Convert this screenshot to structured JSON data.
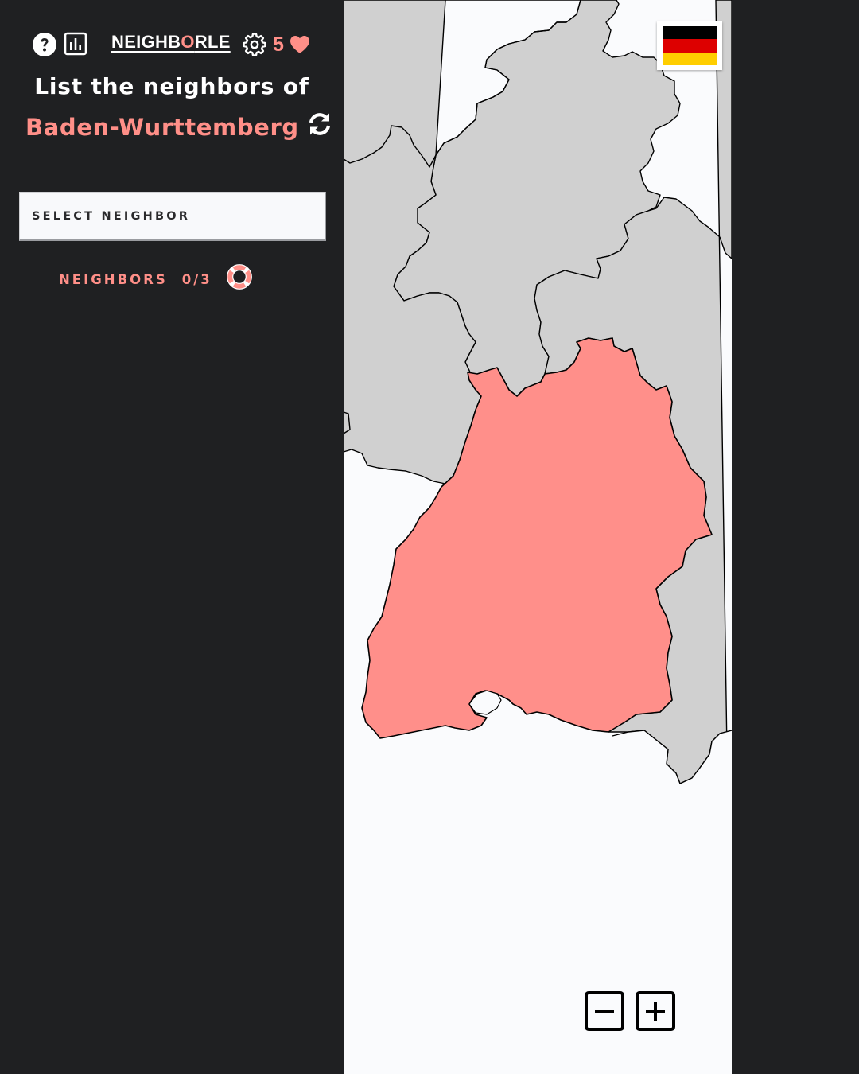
{
  "header": {
    "title_prefix": "NEIGHB",
    "title_highlight": "O",
    "title_suffix": "RLE",
    "lives": "5",
    "icons": {
      "help": "question-circle-icon",
      "stats": "bar-chart-icon",
      "settings": "gear-icon",
      "lives": "heart-icon"
    }
  },
  "prompt": {
    "text": "List the neighbors of",
    "target": "Baden-Wurttemberg",
    "refresh_icon": "refresh-icon"
  },
  "select": {
    "label": "SELECT NEIGHBOR"
  },
  "progress": {
    "label": "NEIGHBORS",
    "count": "0/3",
    "hint_icon": "lifebuoy-icon"
  },
  "map": {
    "country_flag": "germany-flag",
    "flag_colors": [
      "#000000",
      "#dd0000",
      "#ffce00"
    ],
    "highlight_color": "#ff8f8a",
    "neighbor_color": "#d0d0d0",
    "zoom_out_icon": "minus-square-icon",
    "zoom_in_icon": "plus-square-icon"
  },
  "colors": {
    "accent": "#ff8f88",
    "background": "#1f2022"
  }
}
